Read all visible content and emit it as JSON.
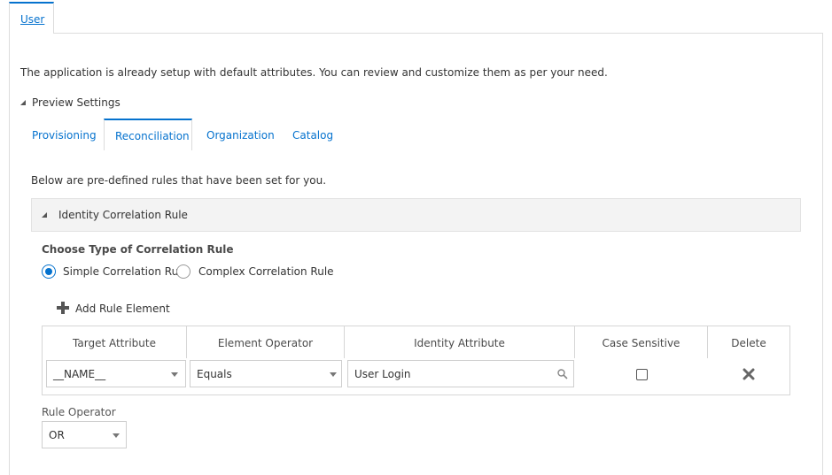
{
  "top_tab": {
    "label": "User"
  },
  "intro_text": "The application is already setup with default attributes. You can review and customize them as per your need.",
  "preview_settings": {
    "label": "Preview Settings"
  },
  "sub_tabs": [
    {
      "label": "Provisioning"
    },
    {
      "label": "Reconciliation",
      "active": true
    },
    {
      "label": "Organization"
    },
    {
      "label": "Catalog"
    }
  ],
  "below_text": "Below are pre-defined rules that have been set for you.",
  "section": {
    "title": "Identity Correlation Rule"
  },
  "correlation": {
    "label": "Choose Type of Correlation Rule",
    "options": [
      {
        "label": "Simple Correlation Rule",
        "checked": true
      },
      {
        "label": "Complex Correlation Rule",
        "checked": false
      }
    ]
  },
  "add_rule": {
    "label": "Add Rule Element"
  },
  "table": {
    "headers": [
      "Target Attribute",
      "Element Operator",
      "Identity Attribute",
      "Case Sensitive",
      "Delete"
    ],
    "row": {
      "target_attribute": "__NAME__",
      "element_operator": "Equals",
      "identity_attribute": "User Login",
      "case_sensitive": false
    }
  },
  "rule_operator": {
    "label": "Rule Operator",
    "value": "OR"
  },
  "colors": {
    "accent": "#0572ce",
    "header_bg": "#f3f3f3"
  }
}
